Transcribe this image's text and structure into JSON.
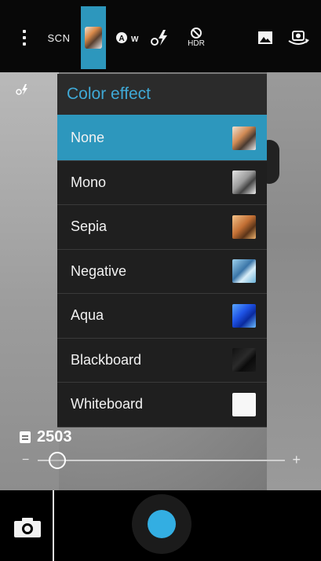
{
  "toolbar": {
    "scn_label": "SCN",
    "hdr_label": "HDR",
    "items": [
      "menu-icon",
      "scene-mode",
      "color-effect",
      "white-balance-auto",
      "flash-auto",
      "hdr-off",
      "gallery",
      "switch-camera"
    ]
  },
  "popup": {
    "title": "Color effect",
    "options": [
      {
        "label": "None",
        "selected": true,
        "swatch": "linear-gradient(135deg,#f1e3d3 0%,#d08a55 40%,#4a3a30 65%,#efefef 100%)"
      },
      {
        "label": "Mono",
        "selected": false,
        "swatch": "linear-gradient(135deg,#e6e6e6 0%,#9a9a9a 45%,#444 65%,#f0f0f0 100%)"
      },
      {
        "label": "Sepia",
        "selected": false,
        "swatch": "linear-gradient(135deg,#f5c38a 0%,#c26f34 45%,#5b3418 70%,#f0b46e 100%)"
      },
      {
        "label": "Negative",
        "selected": false,
        "swatch": "linear-gradient(135deg,#9fd3ef 0%,#3a75a8 45%,#d9eef8 65%,#6ab1d8 100%)"
      },
      {
        "label": "Aqua",
        "selected": false,
        "swatch": "linear-gradient(135deg,#5aa7ff 0%,#1f54e6 40%,#0a2a9e 65%,#6bbcff 100%)"
      },
      {
        "label": "Blackboard",
        "selected": false,
        "swatch": "linear-gradient(135deg,#111 0%,#2b2b2b 45%,#0b0b0b 65%,#1a1a1a 100%)"
      },
      {
        "label": "Whiteboard",
        "selected": false,
        "swatch": "#f7f7f7"
      }
    ]
  },
  "counter": {
    "value": "2503"
  },
  "zoom": {
    "minus": "−",
    "plus": "+",
    "level": 0.08
  },
  "colors": {
    "accent": "#2d97bd",
    "shutter": "#33aee2",
    "title_text": "#3fa9d6"
  }
}
